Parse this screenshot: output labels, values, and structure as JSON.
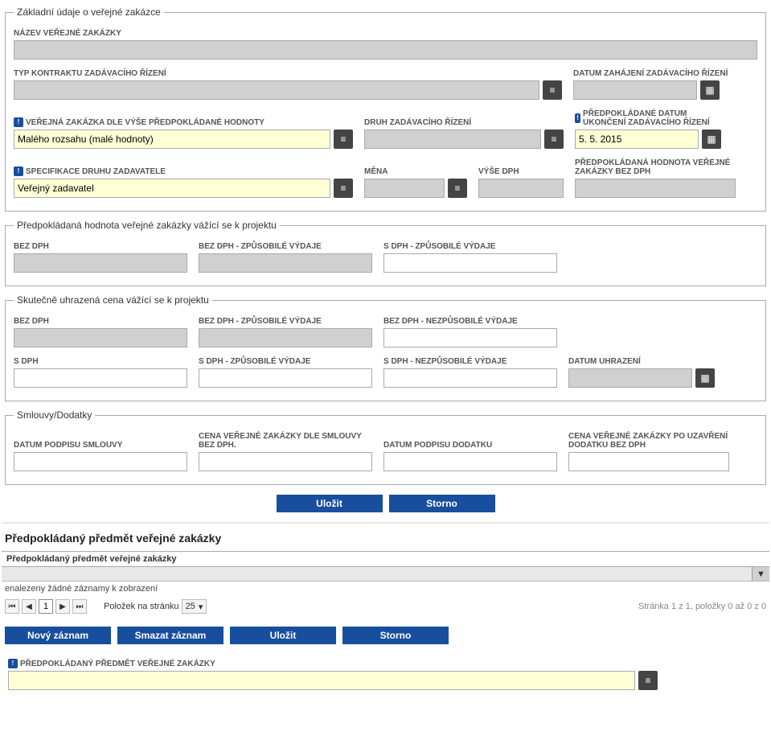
{
  "fs1": {
    "legend": "Základní údaje o veřejné zakázce",
    "nazev_lbl": "NÁZEV VEŘEJNÉ ZAKÁZKY",
    "typ_kontraktu_lbl": "TYP KONTRAKTU ZADÁVACÍHO ŘÍZENÍ",
    "datum_zahajeni_lbl": "DATUM ZAHÁJENÍ ZADÁVACÍHO ŘÍZENÍ",
    "vz_dle_vyse_lbl": "VEŘEJNÁ ZAKÁZKA DLE VÝŠE PŘEDPOKLÁDANÉ HODNOTY",
    "vz_dle_vyse_val": "Malého rozsahu (malé hodnoty)",
    "druh_rizeni_lbl": "DRUH ZADÁVACÍHO ŘÍZENÍ",
    "predp_datum_ukonc_lbl": "PŘEDPOKLÁDANÉ DATUM UKONČENÍ ZADÁVACÍHO ŘÍZENÍ",
    "predp_datum_ukonc_val": "5. 5. 2015",
    "spec_zadavatele_lbl": "SPECIFIKACE DRUHU ZADAVATELE",
    "spec_zadavatele_val": "Veřejný zadavatel",
    "mena_lbl": "MĚNA",
    "vyse_dph_lbl": "VÝŠE DPH",
    "predp_hodnota_bez_dph_lbl": "PŘEDPOKLÁDANÁ HODNOTA VEŘEJNÉ ZAKÁZKY BEZ DPH"
  },
  "fs2": {
    "legend": "Předpokládaná hodnota veřejné zakázky vážící se k projektu",
    "bez_dph_lbl": "BEZ DPH",
    "bez_dph_zp_lbl": "BEZ DPH - ZPŮSOBILÉ VÝDAJE",
    "s_dph_zp_lbl": "S DPH - ZPŮSOBILÉ VÝDAJE"
  },
  "fs3": {
    "legend": "Skutečně uhrazená cena vážící se k projektu",
    "bez_dph_lbl": "BEZ DPH",
    "bez_dph_zp_lbl": "BEZ DPH - ZPŮSOBILÉ VÝDAJE",
    "bez_dph_nzp_lbl": "BEZ DPH - NEZPŮSOBILÉ VÝDAJE",
    "s_dph_lbl": "S DPH",
    "s_dph_zp_lbl": "S DPH - ZPŮSOBILÉ VÝDAJE",
    "s_dph_nzp_lbl": "S DPH - NEZPŮSOBILÉ VÝDAJE",
    "datum_uhr_lbl": "DATUM UHRAZENÍ"
  },
  "fs4": {
    "legend": "Smlouvy/Dodatky",
    "datum_podpisu_sml_lbl": "DATUM PODPISU SMLOUVY",
    "cena_sml_bez_dph_lbl": "CENA VEŘEJNÉ ZAKÁZKY DLE SMLOUVY BEZ DPH.",
    "datum_podpisu_dod_lbl": "DATUM PODPISU DODATKU",
    "cena_po_uzav_lbl": "CENA VEŘEJNÉ ZAKÁZKY PO UZAVŘENÍ DODATKU BEZ DPH"
  },
  "buttons": {
    "ulozit": "Uložit",
    "storno": "Storno",
    "novy": "Nový záznam",
    "smazat": "Smazat záznam"
  },
  "section2": {
    "title": "Předpokládaný předmět veřejné zakázky",
    "grid_col": "Předpokládaný předmět veřejné zakázky",
    "empty": "enalezeny žádné záznamy k zobrazení",
    "polozek": "Položek na stránku",
    "page_size": "25",
    "page_num": "1",
    "pager_info": "Stránka 1 z 1, položky 0 až 0 z 0",
    "predp_predmet_lbl": "PŘEDPOKLÁDANÝ PŘEDMĚT VEŘEJNÉ ZAKÁZKY"
  },
  "icons": {
    "list": "≡",
    "cal": "▦",
    "filter": "▼",
    "req": "!"
  }
}
